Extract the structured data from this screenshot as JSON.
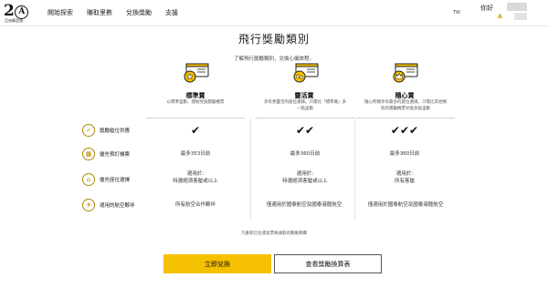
{
  "header": {
    "logo_mark": "2",
    "logo_letter": "A",
    "logo_text": "亞洲萬里通",
    "nav": [
      "開始探索",
      "賺取里數",
      "兌換獎勵",
      "支援"
    ],
    "lang_badge": "TW",
    "greeting": "你好",
    "user_level": "A"
  },
  "main": {
    "title": "飛行獎勵類別",
    "subtitle": "了解飛行獎勵類別，兌換心儀旅程。"
  },
  "tiers": [
    {
      "name": "標準賞",
      "desc": "以標準里數，開始兌換獎勵機票",
      "icon": "star-ticket-icon"
    },
    {
      "name": "靈活賞",
      "desc": "享有更靈活的座位選擇。只需比「標準賞」多一點里數",
      "icon": "stars-ticket-icon"
    },
    {
      "name": "隨心賞",
      "desc": "隨心所願享有最多的座位選擇。只需比其他類別的獎勵機票兌換多點里數",
      "icon": "crown-ticket-icon"
    }
  ],
  "rows": [
    {
      "label": "獎勵艙位供應",
      "icon": "check-circle-icon",
      "cells": [
        "✔",
        "✔✔",
        "✔✔✔"
      ]
    },
    {
      "label": "優先預訂機票",
      "icon": "calendar-icon",
      "cells": [
        "最多353日前",
        "最多360日前",
        "最多360日前"
      ]
    },
    {
      "label": "優先座位選擇",
      "icon": "seat-icon",
      "cells": [
        "適用於:\n特選經濟客艙或以上",
        "適用於:\n特選經濟客艙或以上",
        "適用於:\n所有客艙"
      ]
    },
    {
      "label": "適用的航空夥伴",
      "icon": "plane-icon",
      "cells": [
        "所有航空合作夥伴",
        "僅適用於國泰航空及國泰港龍航空",
        "僅適用於國泰航空及國泰港龍航空"
      ]
    }
  ],
  "note": "凡重新訂位或退票將收取有關服務費",
  "buttons": {
    "primary": "立即兌換",
    "secondary": "查看獎勵換算表"
  },
  "colors": {
    "accent": "#f5c000",
    "gold_outline": "#b08a00"
  }
}
